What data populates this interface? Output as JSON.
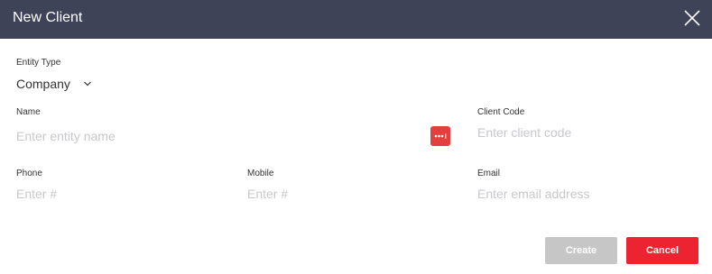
{
  "dialog": {
    "title": "New Client"
  },
  "form": {
    "entity_type": {
      "label": "Entity Type",
      "value": "Company"
    },
    "name": {
      "label": "Name",
      "placeholder": "Enter entity name",
      "value": ""
    },
    "client_code": {
      "label": "Client Code",
      "placeholder": "Enter client code",
      "value": ""
    },
    "phone": {
      "label": "Phone",
      "placeholder": "Enter #",
      "value": ""
    },
    "mobile": {
      "label": "Mobile",
      "placeholder": "Enter #",
      "value": ""
    },
    "email": {
      "label": "Email",
      "placeholder": "Enter email address",
      "value": ""
    }
  },
  "buttons": {
    "create": "Create",
    "cancel": "Cancel"
  },
  "icons": {
    "close": "close-icon",
    "chevron": "chevron-down-icon",
    "password_manager": "password-manager-icon"
  },
  "colors": {
    "header_bg": "#3f4358",
    "create_disabled": "#c6c6c6",
    "cancel": "#ec2331",
    "pw_icon": "#e2403f"
  }
}
